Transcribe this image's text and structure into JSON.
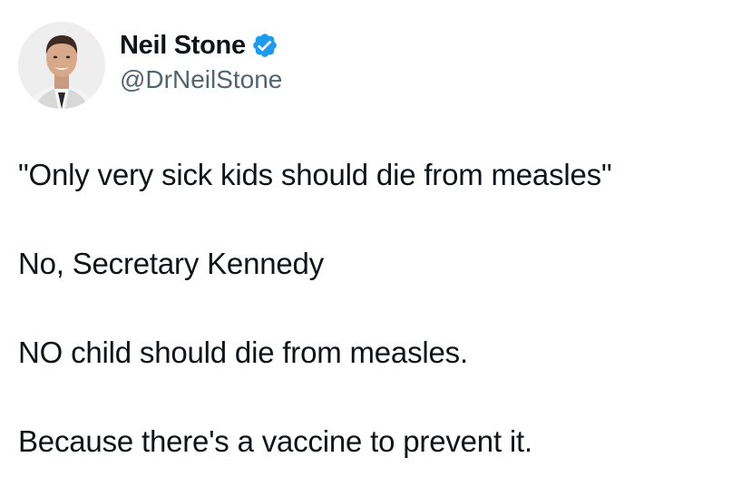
{
  "author": {
    "display_name": "Neil Stone",
    "handle": "@DrNeilStone",
    "verified": true,
    "verified_color": "#1d9bf0",
    "avatar_icon": "profile-photo-man"
  },
  "tweet": {
    "paragraphs": [
      "\"Only very sick kids should die from measles\"",
      "No, Secretary Kennedy",
      "NO child should die from measles.",
      "Because there's a vaccine to prevent it."
    ]
  }
}
